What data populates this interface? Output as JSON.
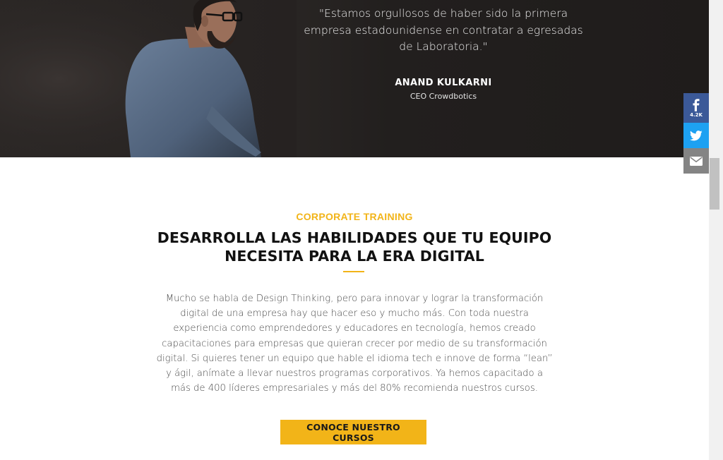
{
  "testimonial": {
    "quote": "\"Estamos orgullosos de haber sido la primera empresa estadounidense en contratar a egresadas de Laboratoria.\"",
    "author": "ANAND KULKARNI",
    "role": "CEO Crowdbotics"
  },
  "share": {
    "facebook_count": "4.2K",
    "icons": [
      "facebook-icon",
      "twitter-icon",
      "email-icon"
    ]
  },
  "section": {
    "eyebrow": "CORPORATE TRAINING",
    "heading": "DESARROLLA LAS HABILIDADES QUE TU EQUIPO NECESITA PARA LA ERA DIGITAL",
    "body": "Mucho se habla de Design Thinking, pero para innovar y lograr la transformación digital de una empresa hay que hacer eso y mucho más. Con toda nuestra experiencia como emprendedores y educadores en tecnología, hemos creado capacitaciones para empresas que quieran crecer por medio de su transformación digital. Si quieres tener un equipo que hable el idioma tech e innove de forma “lean” y ágil, anímate a llevar nuestros programas corporativos. Ya hemos capacitado a más de 400 líderes empresariales y más del 80% recomienda nuestros cursos.",
    "cta_label": "CONOCE NUESTRO CURSOS"
  },
  "colors": {
    "accent": "#f2b418",
    "facebook": "#3b5998",
    "twitter": "#1da1f2",
    "email": "#848484"
  }
}
